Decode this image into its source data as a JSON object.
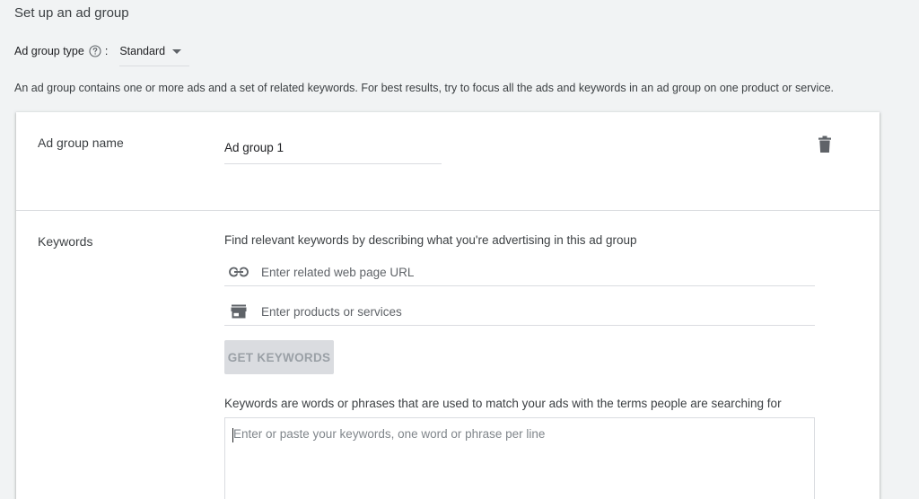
{
  "header": {
    "title": "Set up an ad group",
    "ad_group_type_label": "Ad group type",
    "colon": ":",
    "ad_group_type_value": "Standard",
    "description": "An ad group contains one or more ads and a set of related keywords. For best results, try to focus all the ads and keywords in an ad group on one product or service."
  },
  "ad_group": {
    "name_label": "Ad group name",
    "name_value": "Ad group 1"
  },
  "keywords": {
    "label": "Keywords",
    "finder_hint": "Find relevant keywords by describing what you're advertising in this ad group",
    "url_placeholder": "Enter related web page URL",
    "products_placeholder": "Enter products or services",
    "get_keywords_button": "GET KEYWORDS",
    "keywords_hint": "Keywords are words or phrases that are used to match your ads with the terms people are searching for",
    "keywords_placeholder": "Enter or paste your keywords, one word or phrase per line"
  },
  "icons": {
    "help": "help-circle-icon",
    "dropdown": "dropdown-caret-icon",
    "delete": "trash-icon",
    "link": "link-icon",
    "store": "store-icon"
  },
  "colors": {
    "background": "#f1f3f4",
    "card": "#ffffff",
    "disabled_button_bg": "#dadce0",
    "disabled_button_text": "#9aa0a6",
    "icon": "#5f6368"
  }
}
